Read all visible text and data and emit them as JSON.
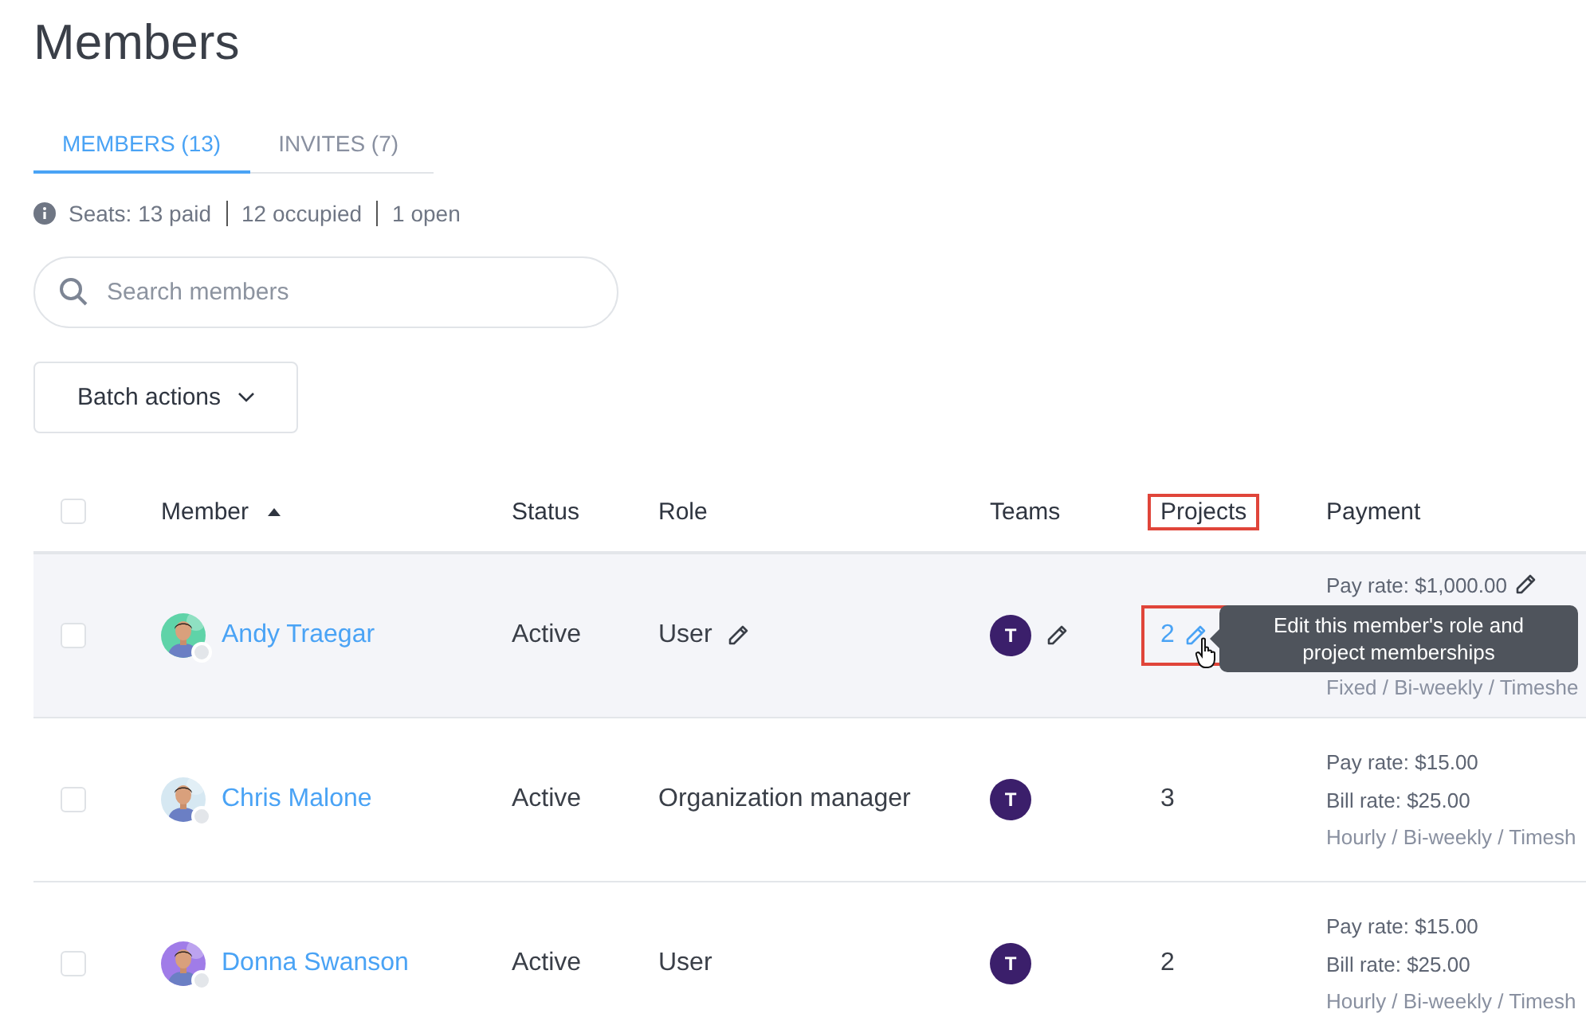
{
  "title": "Members",
  "tabs": [
    {
      "label": "MEMBERS (13)",
      "selected": true
    },
    {
      "label": "INVITES (7)",
      "selected": false
    }
  ],
  "seats": [
    "Seats: 13 paid",
    "12 occupied",
    "1 open"
  ],
  "search": {
    "placeholder": "Search members"
  },
  "batch_button": "Batch actions",
  "table": {
    "header_checked": false,
    "columns": [
      {
        "label": "Member",
        "sorted": true,
        "highlighted": false
      },
      {
        "label": "Status",
        "sorted": false,
        "highlighted": false
      },
      {
        "label": "Role",
        "sorted": false,
        "highlighted": false
      },
      {
        "label": "Teams",
        "sorted": false,
        "highlighted": false
      },
      {
        "label": "Projects",
        "sorted": false,
        "highlighted": true
      },
      {
        "label": "Payment",
        "sorted": false,
        "highlighted": false
      }
    ],
    "rows": [
      {
        "checked": false,
        "hovered": true,
        "name": "Andy Traegar",
        "avatar": {
          "kind": "picture"
        },
        "status": "Active",
        "role": "User",
        "role_editable": true,
        "team": "T",
        "team_editable": true,
        "projects": "2",
        "projects_editable": true,
        "projects_highlighted": true,
        "payment": [
          "Pay rate: $1,000.00",
          "Fixed / Bi-weekly / Timeshe"
        ],
        "payment_editable": true
      },
      {
        "checked": false,
        "hovered": false,
        "name": "Chris Malone",
        "avatar": {
          "kind": "picture"
        },
        "status": "Active",
        "role": "Organization manager",
        "role_editable": false,
        "team": "T",
        "team_editable": false,
        "projects": "3",
        "projects_editable": false,
        "projects_highlighted": false,
        "payment": [
          "Pay rate: $15.00",
          "Bill rate: $25.00",
          "Hourly / Bi-weekly / Timesh"
        ],
        "payment_editable": false
      },
      {
        "checked": false,
        "hovered": false,
        "name": "Donna Swanson",
        "avatar": {
          "kind": "picture"
        },
        "status": "Active",
        "role": "User",
        "role_editable": false,
        "team": "T",
        "team_editable": false,
        "projects": "2",
        "projects_editable": false,
        "projects_highlighted": false,
        "payment": [
          "Pay rate: $15.00",
          "Bill rate: $25.00",
          "Hourly / Bi-weekly / Timesh"
        ],
        "payment_editable": false
      }
    ]
  },
  "tooltip": {
    "text": "Edit this member's role and project memberships"
  }
}
